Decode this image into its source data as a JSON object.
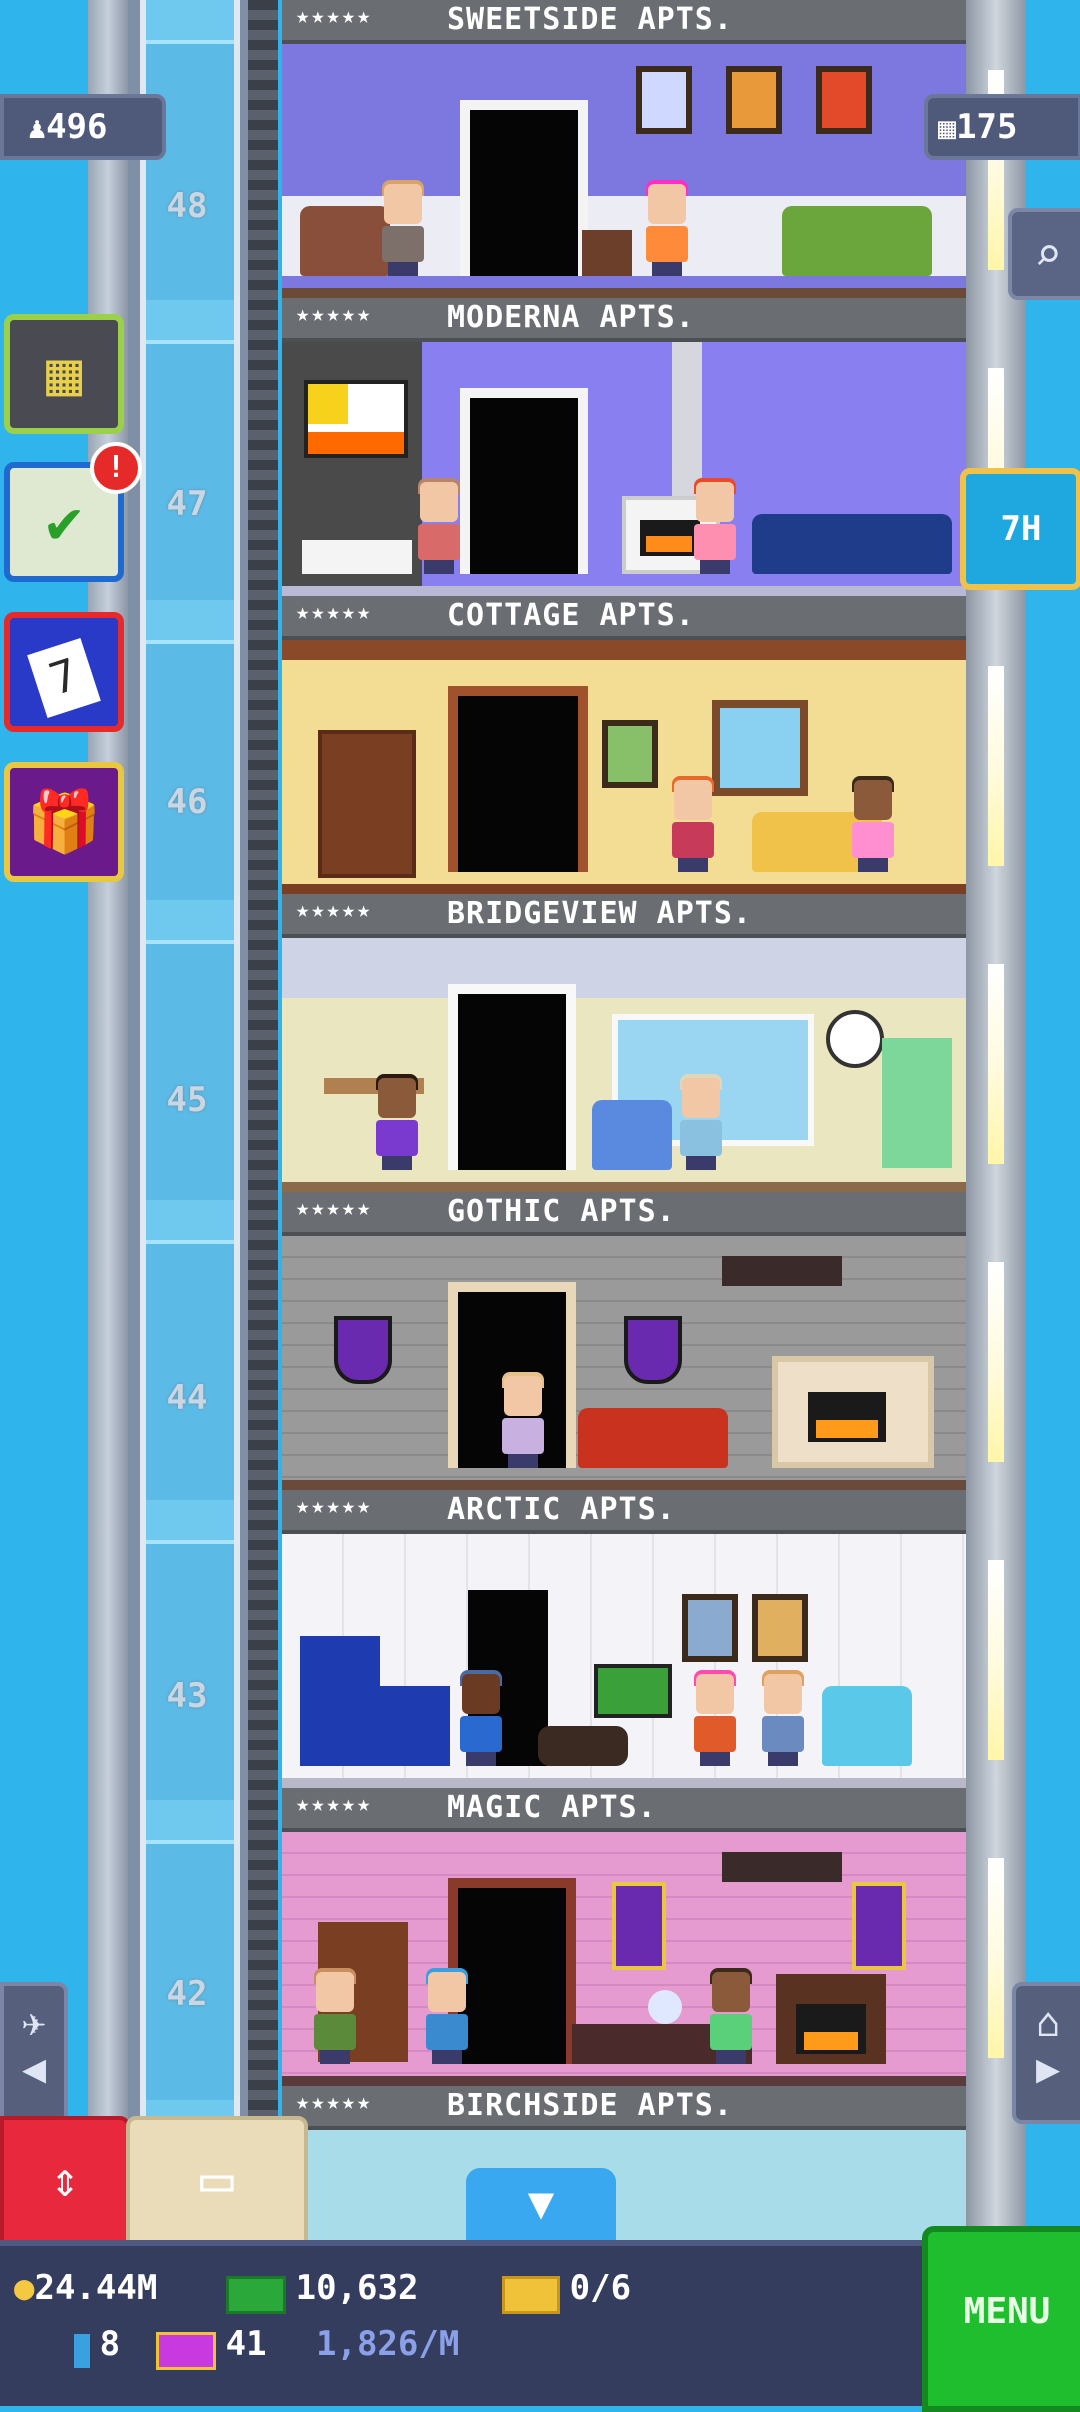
{
  "hud": {
    "population": "496",
    "bux_stat": "175",
    "timer_label": "7H",
    "mission_badge": "!",
    "calendar_day": "7"
  },
  "floors": [
    {
      "number": "48",
      "name": "SWEETSIDE APTS.",
      "stars": "★★★★★"
    },
    {
      "number": "47",
      "name": "MODERNA APTS.",
      "stars": "★★★★★"
    },
    {
      "number": "46",
      "name": "COTTAGE APTS.",
      "stars": "★★★★★"
    },
    {
      "number": "45",
      "name": "BRIDGEVIEW APTS.",
      "stars": "★★★★★"
    },
    {
      "number": "44",
      "name": "GOTHIC APTS.",
      "stars": "★★★★★"
    },
    {
      "number": "43",
      "name": "ARCTIC APTS.",
      "stars": "★★★★★"
    },
    {
      "number": "42",
      "name": "MAGIC APTS.",
      "stars": "★★★★★"
    },
    {
      "number": "",
      "name": "BIRCHSIDE APTS.",
      "stars": "★★★★★"
    }
  ],
  "bottom": {
    "coins": "24.44M",
    "bux": "10,632",
    "tickets": "0/6",
    "vip": "8",
    "tower_bux": "41",
    "income_rate": "1,826/M",
    "menu_label": "MENU"
  },
  "colors": {
    "sky": "#2fb4ec",
    "menu_green": "#1fbe2f",
    "elevator_red": "#e8283c",
    "panel": "#353d5e"
  },
  "icons": [
    "population-icon",
    "bux-icon",
    "search-icon",
    "building-icon",
    "mission-icon",
    "calendar-icon",
    "gift-icon",
    "plane-icon",
    "home-icon",
    "elevator-arrows-icon",
    "storage-box-icon",
    "down-arrow-icon",
    "coin-icon",
    "cash-icon",
    "ticket-icon",
    "vip-icon",
    "tower-bux-icon"
  ]
}
